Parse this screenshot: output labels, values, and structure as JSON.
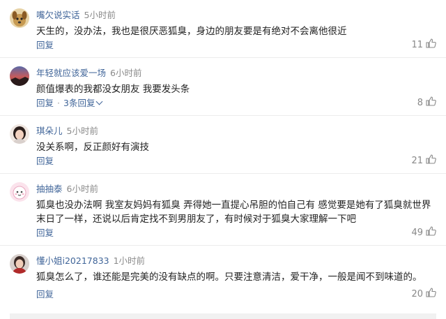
{
  "comments": [
    {
      "user": "嘴欠说实话",
      "time": "5小时前",
      "text": "天生的，没办法，我也是很厌恶狐臭，身边的朋友要是有绝对不会离他很近",
      "reply_label": "回复",
      "likes": "11",
      "avatar": "dog-avatar"
    },
    {
      "user": "年轻就应该爱一场",
      "time": "6小时前",
      "text": "颜值爆表的我都没女朋友 我要发头条",
      "reply_label": "回复",
      "replies_label": "3条回复",
      "likes": "8",
      "avatar": "sunset-avatar"
    },
    {
      "user": "琪朵儿",
      "time": "5小时前",
      "text": "没关系啊，反正颜好有演技",
      "reply_label": "回复",
      "likes": "21",
      "avatar": "girl-avatar"
    },
    {
      "user": "抽抽泰",
      "time": "6小时前",
      "text": "狐臭也没办法啊 我室友妈妈有狐臭 弄得她一直提心吊胆的怕自己有 感觉要是她有了狐臭就世界末日了一样，还说以后肯定找不到男朋友了，有时候对于狐臭大家理解一下吧",
      "reply_label": "回复",
      "likes": "49",
      "avatar": "cartoon-avatar"
    },
    {
      "user": "懂小姐i20217833",
      "time": "1小时前",
      "text": "狐臭怎么了，谁还能是完美的没有缺点的啊。只要注意清洁，爱干净，一般是闻不到味道的。",
      "reply_label": "回复",
      "likes": "20",
      "avatar": "woman-avatar"
    }
  ],
  "colors": {
    "username": "#406599",
    "time": "#8a8a8a",
    "text": "#222222",
    "like": "#888888"
  }
}
